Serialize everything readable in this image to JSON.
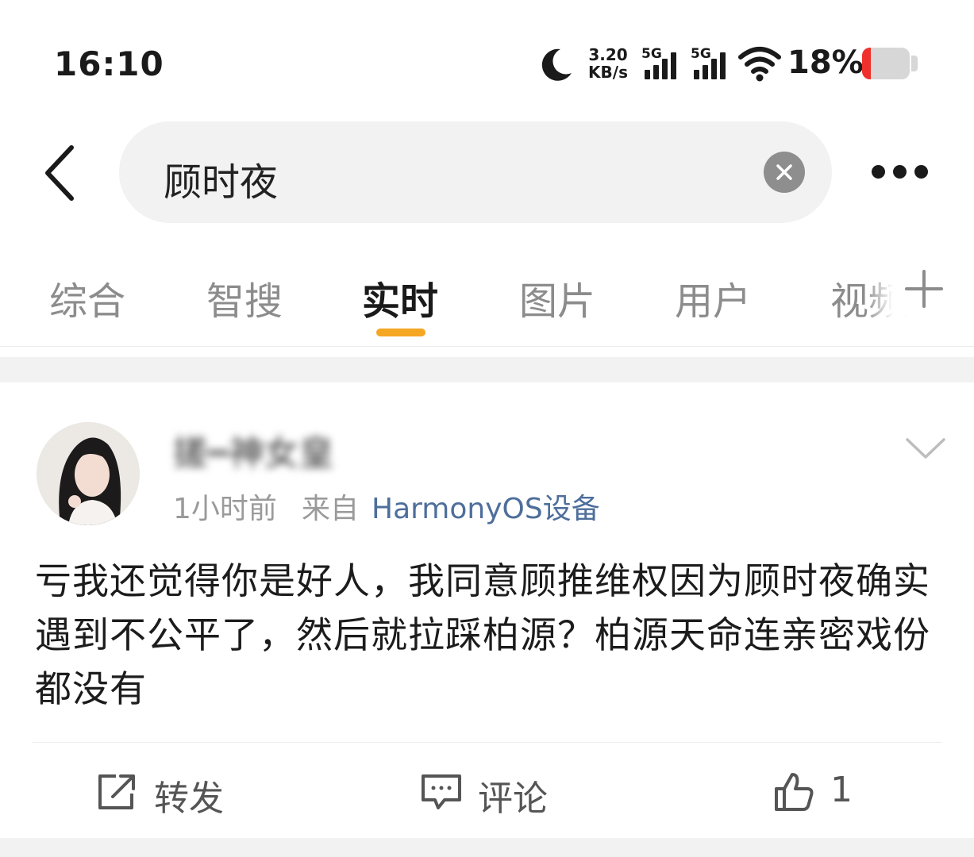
{
  "status_bar": {
    "time": "16:10",
    "net_speed_value": "3.20",
    "net_speed_unit": "KB/s",
    "sim1_label": "5G",
    "sim2_label": "5G",
    "battery_percent": "18%",
    "battery_level": 0.18,
    "icons": [
      "moon-icon",
      "signal-icon",
      "wifi-icon",
      "battery-icon"
    ]
  },
  "search": {
    "query": "顾时夜",
    "icons": [
      "back-arrow-icon",
      "clear-icon",
      "more-icon"
    ]
  },
  "tabs": [
    {
      "label": "综合",
      "active": false
    },
    {
      "label": "智搜",
      "active": false
    },
    {
      "label": "实时",
      "active": true
    },
    {
      "label": "图片",
      "active": false
    },
    {
      "label": "用户",
      "active": false
    },
    {
      "label": "视频",
      "active": false
    }
  ],
  "post": {
    "username": "搓┅神女皇",
    "time": "1小时前",
    "from_label": "来自",
    "source": "HarmonyOS设备",
    "content": "亏我还觉得你是好人，我同意顾推维权因为顾时夜确实遇到不公平了，然后就拉踩柏源？柏源天命连亲密戏份都没有",
    "actions": {
      "repost_label": "转发",
      "comment_label": "评论",
      "like_count": "1"
    }
  },
  "colors": {
    "accent": "#f5a623",
    "link": "#4e6e9b",
    "battery_low": "#f0302c"
  }
}
